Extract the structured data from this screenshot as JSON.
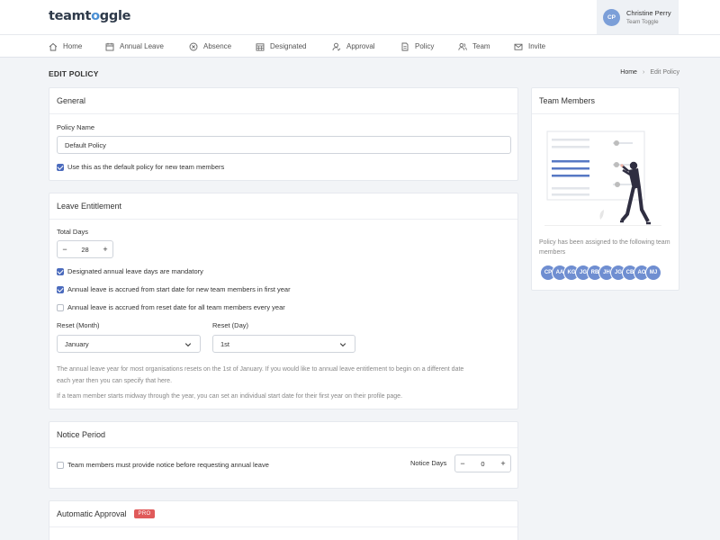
{
  "brand": {
    "logo_prefix": "team",
    "logo_accent_o": "o",
    "logo_suffix": "ggle",
    "logo_t": "t",
    "accent_color": "#4a8fd4"
  },
  "user": {
    "initials": "CP",
    "name": "Christine Perry",
    "team": "Team Toggle"
  },
  "nav": {
    "items": [
      {
        "label": "Home",
        "icon": "home-icon"
      },
      {
        "label": "Annual Leave",
        "icon": "calendar-icon"
      },
      {
        "label": "Absence",
        "icon": "cancel-circle-icon"
      },
      {
        "label": "Designated",
        "icon": "calendar-grid-icon"
      },
      {
        "label": "Approval",
        "icon": "user-check-icon"
      },
      {
        "label": "Policy",
        "icon": "document-icon"
      },
      {
        "label": "Team",
        "icon": "team-icon"
      },
      {
        "label": "Invite",
        "icon": "envelope-icon"
      }
    ]
  },
  "page": {
    "title": "EDIT POLICY",
    "breadcrumb": {
      "home": "Home",
      "separator": "›",
      "current": "Edit Policy"
    }
  },
  "general": {
    "title": "General",
    "policy_name_label": "Policy Name",
    "policy_name_value": "Default Policy",
    "default_checkbox_label": "Use this as the default policy for new team members",
    "default_checked": true
  },
  "leave": {
    "title": "Leave Entitlement",
    "total_days_label": "Total Days",
    "total_days_value": "28",
    "minus": "−",
    "plus": "+",
    "check_mandatory": "Designated annual leave days are mandatory",
    "check_mandatory_checked": true,
    "check_start_date": "Annual leave is accrued from start date for new team members in first year",
    "check_start_date_checked": true,
    "check_reset_date": "Annual leave is accrued from reset date for all team members every year",
    "check_reset_date_checked": false,
    "reset_month_label": "Reset (Month)",
    "reset_month_value": "January",
    "reset_day_label": "Reset (Day)",
    "reset_day_value": "1st",
    "help_line1": "The annual leave year for most organisations resets on the 1st of January. If you would like to annual leave entitlement to begin on a different date",
    "help_line2": "each year then you can specify that here.",
    "help_line3": "If a team member starts midway through the year, you can set an individual start date for their first year on their profile page."
  },
  "notice": {
    "title": "Notice Period",
    "checkbox_label": "Team members must provide notice before requesting annual leave",
    "checked": false,
    "days_label": "Notice Days",
    "days_value": "0",
    "minus": "−",
    "plus": "+"
  },
  "auto_approval": {
    "title": "Automatic Approval",
    "badge": "PRO",
    "badge_color": "#e05a5a"
  },
  "team_members": {
    "title": "Team Members",
    "assigned_text": "Policy has been assigned to the following team members",
    "avatars": [
      "CP",
      "AA",
      "KG",
      "JG",
      "RB",
      "JH",
      "JG",
      "CB",
      "AO",
      "MJ"
    ],
    "avatar_color": "#6f8ed1"
  }
}
